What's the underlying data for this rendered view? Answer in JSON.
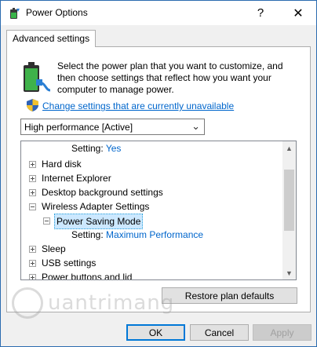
{
  "window": {
    "title": "Power Options",
    "help_glyph": "?",
    "close_glyph": "✕"
  },
  "tab": {
    "label": "Advanced settings"
  },
  "intro": {
    "description": "Select the power plan that you want to customize, and then choose settings that reflect how you want your computer to manage power.",
    "change_link": "Change settings that are currently unavailable"
  },
  "plan_select": {
    "selected": "High performance [Active]"
  },
  "tree": {
    "items": [
      {
        "type": "setting",
        "label": "Setting:",
        "value": "Yes"
      },
      {
        "type": "node",
        "label": "Hard disk",
        "expanded": false
      },
      {
        "type": "node",
        "label": "Internet Explorer",
        "expanded": false
      },
      {
        "type": "node",
        "label": "Desktop background settings",
        "expanded": false
      },
      {
        "type": "node",
        "label": "Wireless Adapter Settings",
        "expanded": true
      },
      {
        "type": "node",
        "label": "Power Saving Mode",
        "expanded": true,
        "selected": true
      },
      {
        "type": "setting",
        "label": "Setting:",
        "value": "Maximum Performance"
      },
      {
        "type": "node",
        "label": "Sleep",
        "expanded": false
      },
      {
        "type": "node",
        "label": "USB settings",
        "expanded": false
      },
      {
        "type": "node",
        "label": "Power buttons and lid",
        "expanded": false
      }
    ]
  },
  "buttons": {
    "restore": "Restore plan defaults",
    "ok": "OK",
    "cancel": "Cancel",
    "apply": "Apply"
  },
  "watermark": {
    "text": "uantrimang"
  },
  "colors": {
    "link": "#0066cc",
    "selection": "#cce8ff",
    "focus_border": "#0078d7"
  }
}
